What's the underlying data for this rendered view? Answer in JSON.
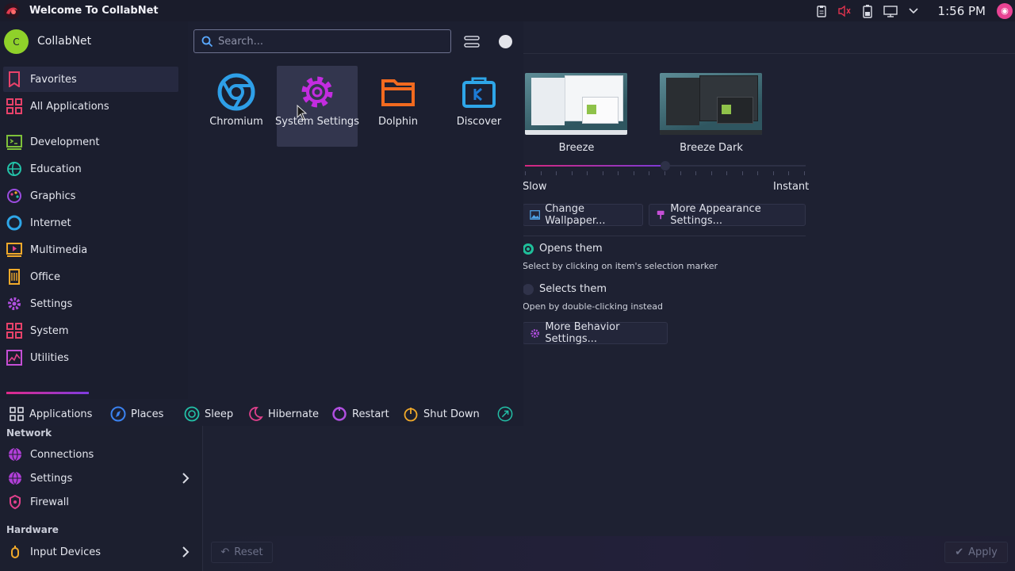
{
  "topbar": {
    "window_title": "Welcome To CollabNet",
    "clock": "1:56 PM",
    "tray_icons": [
      "clipboard-icon",
      "volume-muted-icon",
      "battery-icon",
      "network-icon",
      "chevron-down-icon"
    ]
  },
  "menu": {
    "user_initial": "C",
    "username": "CollabNet",
    "search_placeholder": "Search...",
    "categories": [
      {
        "label": "Favorites",
        "icon": "bookmark-icon",
        "selected": true
      },
      {
        "label": "All Applications",
        "icon": "grid-icon"
      },
      {
        "label": "Development",
        "icon": "development-icon"
      },
      {
        "label": "Education",
        "icon": "education-icon"
      },
      {
        "label": "Graphics",
        "icon": "graphics-icon"
      },
      {
        "label": "Internet",
        "icon": "internet-icon"
      },
      {
        "label": "Multimedia",
        "icon": "multimedia-icon"
      },
      {
        "label": "Office",
        "icon": "office-icon"
      },
      {
        "label": "Settings",
        "icon": "settings-icon"
      },
      {
        "label": "System",
        "icon": "system-icon"
      },
      {
        "label": "Utilities",
        "icon": "utilities-icon"
      }
    ],
    "favorites": [
      {
        "label": "Chromium",
        "icon": "chromium-icon"
      },
      {
        "label": "System Settings",
        "icon": "system-settings-icon"
      },
      {
        "label": "Dolphin",
        "icon": "dolphin-icon"
      },
      {
        "label": "Discover",
        "icon": "discover-icon"
      }
    ],
    "footer": {
      "applications": "Applications",
      "places": "Places",
      "sleep": "Sleep",
      "hibernate": "Hibernate",
      "restart": "Restart",
      "shutdown": "Shut Down"
    }
  },
  "settings": {
    "themes": [
      {
        "label": "Breeze"
      },
      {
        "label": "Breeze Dark"
      }
    ],
    "animation_speed": {
      "min_label": "Slow",
      "max_label": "Instant",
      "value_fraction": 0.5
    },
    "change_wallpaper": "Change Wallpaper...",
    "more_appearance": "More Appearance Settings...",
    "click_behavior": {
      "opens_label": "Opens them",
      "opens_desc": "Select by clicking on item's selection marker",
      "selects_label": "Selects them",
      "selects_desc": "Open by double-clicking instead"
    },
    "more_behavior": "More Behavior Settings...",
    "reset": "Reset",
    "apply": "Apply",
    "sidebar": {
      "network_header": "Network",
      "connections": "Connections",
      "settings": "Settings",
      "firewall": "Firewall",
      "hardware_header": "Hardware",
      "input_devices": "Input Devices"
    }
  },
  "colors": {
    "accent_pink": "#e02a8a",
    "accent_purple": "#7e3ce0",
    "accent_teal": "#1fbf9a",
    "background": "#1d2031"
  }
}
